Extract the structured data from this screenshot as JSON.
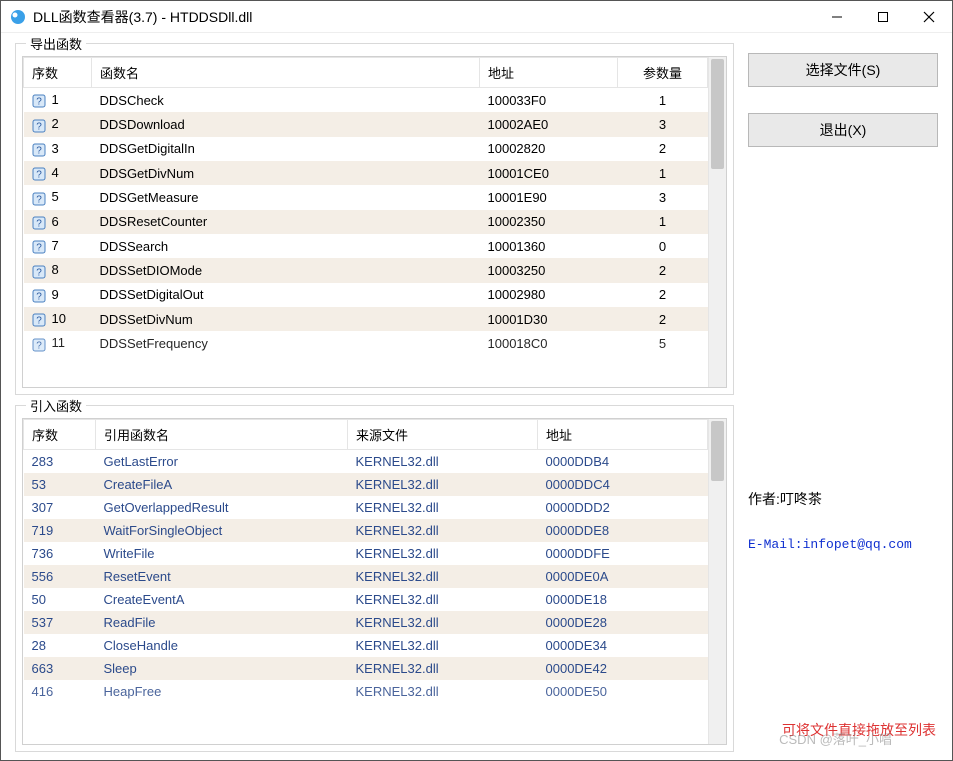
{
  "window": {
    "title": "DLL函数查看器(3.7) - HTDDSDll.dll"
  },
  "export": {
    "label": "导出函数",
    "headers": {
      "seq": "序数",
      "name": "函数名",
      "addr": "地址",
      "argc": "参数量"
    },
    "rows": [
      {
        "seq": "1",
        "name": "DDSCheck",
        "addr": "100033F0",
        "argc": "1"
      },
      {
        "seq": "2",
        "name": "DDSDownload",
        "addr": "10002AE0",
        "argc": "3"
      },
      {
        "seq": "3",
        "name": "DDSGetDigitalIn",
        "addr": "10002820",
        "argc": "2"
      },
      {
        "seq": "4",
        "name": "DDSGetDivNum",
        "addr": "10001CE0",
        "argc": "1"
      },
      {
        "seq": "5",
        "name": "DDSGetMeasure",
        "addr": "10001E90",
        "argc": "3"
      },
      {
        "seq": "6",
        "name": "DDSResetCounter",
        "addr": "10002350",
        "argc": "1"
      },
      {
        "seq": "7",
        "name": "DDSSearch",
        "addr": "10001360",
        "argc": "0"
      },
      {
        "seq": "8",
        "name": "DDSSetDIOMode",
        "addr": "10003250",
        "argc": "2"
      },
      {
        "seq": "9",
        "name": "DDSSetDigitalOut",
        "addr": "10002980",
        "argc": "2"
      },
      {
        "seq": "10",
        "name": "DDSSetDivNum",
        "addr": "10001D30",
        "argc": "2"
      },
      {
        "seq": "11",
        "name": "DDSSetFrequency",
        "addr": "100018C0",
        "argc": "5"
      }
    ]
  },
  "import": {
    "label": "引入函数",
    "headers": {
      "seq": "序数",
      "name": "引用函数名",
      "src": "来源文件",
      "addr": "地址"
    },
    "rows": [
      {
        "seq": "283",
        "name": "GetLastError",
        "src": "KERNEL32.dll",
        "addr": "0000DDB4"
      },
      {
        "seq": "53",
        "name": "CreateFileA",
        "src": "KERNEL32.dll",
        "addr": "0000DDC4"
      },
      {
        "seq": "307",
        "name": "GetOverlappedResult",
        "src": "KERNEL32.dll",
        "addr": "0000DDD2"
      },
      {
        "seq": "719",
        "name": "WaitForSingleObject",
        "src": "KERNEL32.dll",
        "addr": "0000DDE8"
      },
      {
        "seq": "736",
        "name": "WriteFile",
        "src": "KERNEL32.dll",
        "addr": "0000DDFE"
      },
      {
        "seq": "556",
        "name": "ResetEvent",
        "src": "KERNEL32.dll",
        "addr": "0000DE0A"
      },
      {
        "seq": "50",
        "name": "CreateEventA",
        "src": "KERNEL32.dll",
        "addr": "0000DE18"
      },
      {
        "seq": "537",
        "name": "ReadFile",
        "src": "KERNEL32.dll",
        "addr": "0000DE28"
      },
      {
        "seq": "28",
        "name": "CloseHandle",
        "src": "KERNEL32.dll",
        "addr": "0000DE34"
      },
      {
        "seq": "663",
        "name": "Sleep",
        "src": "KERNEL32.dll",
        "addr": "0000DE42"
      },
      {
        "seq": "416",
        "name": "HeapFree",
        "src": "KERNEL32.dll",
        "addr": "0000DE50"
      }
    ]
  },
  "buttons": {
    "choose": "选择文件(S)",
    "exit": "退出(X)"
  },
  "sidebar": {
    "author_label": "作者:叮咚茶",
    "email_label": "E-Mail:",
    "email_value": "infopet@qq.com"
  },
  "hint": "可将文件直接拖放至列表",
  "watermark": "CSDN @落叶_小唱"
}
